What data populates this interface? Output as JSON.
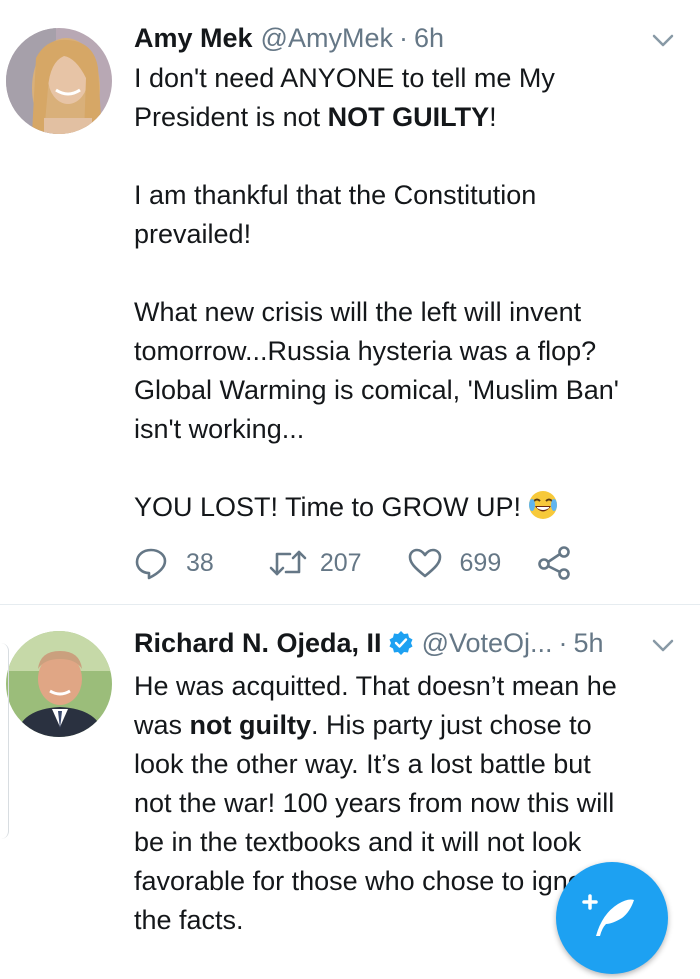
{
  "tweets": [
    {
      "author": "Amy Mek",
      "handle": "@AmyMek",
      "dot": "·",
      "time": "6h",
      "lines": {
        "l1": "I don't need ANYONE to tell me My",
        "l2a": "President is not ",
        "l2b": "NOT GUILTY",
        "l2c": "!",
        "l3": "I am thankful that the Constitution",
        "l4": "prevailed!",
        "l5": "What new crisis will the left will invent",
        "l6": "tomorrow...Russia hysteria was a flop?",
        "l7": "Global Warming is comical, 'Muslim Ban'",
        "l8": "isn't working...",
        "l9": "YOU LOST! Time to GROW UP!"
      },
      "emoji": "face-with-tears-of-joy",
      "replies": "38",
      "retweets": "207",
      "likes": "699"
    },
    {
      "author": "Richard N. Ojeda, II",
      "handle": "@VoteOj...",
      "dot": "·",
      "time": "5h",
      "lines": {
        "l1": "He was acquitted.  That doesn’t mean he",
        "l2a": "was ",
        "l2b": "not guilty",
        "l2c": ".  His party just chose to",
        "l3": "look the other way.  It’s a lost battle but",
        "l4": "not the war!  100 years from now this will",
        "l5": "be in the textbooks and it will not look",
        "l6": "favorable for those who chose to ignore",
        "l7": "the facts."
      }
    }
  ],
  "icons": {
    "reply": "reply-icon",
    "retweet": "retweet-icon",
    "like": "heart-icon",
    "share": "share-icon",
    "caret": "chevron-down-icon",
    "verified": "verified-badge-icon",
    "compose": "compose-tweet-icon"
  },
  "colors": {
    "accent": "#1da1f2",
    "text": "#14171a",
    "muted": "#657786"
  }
}
